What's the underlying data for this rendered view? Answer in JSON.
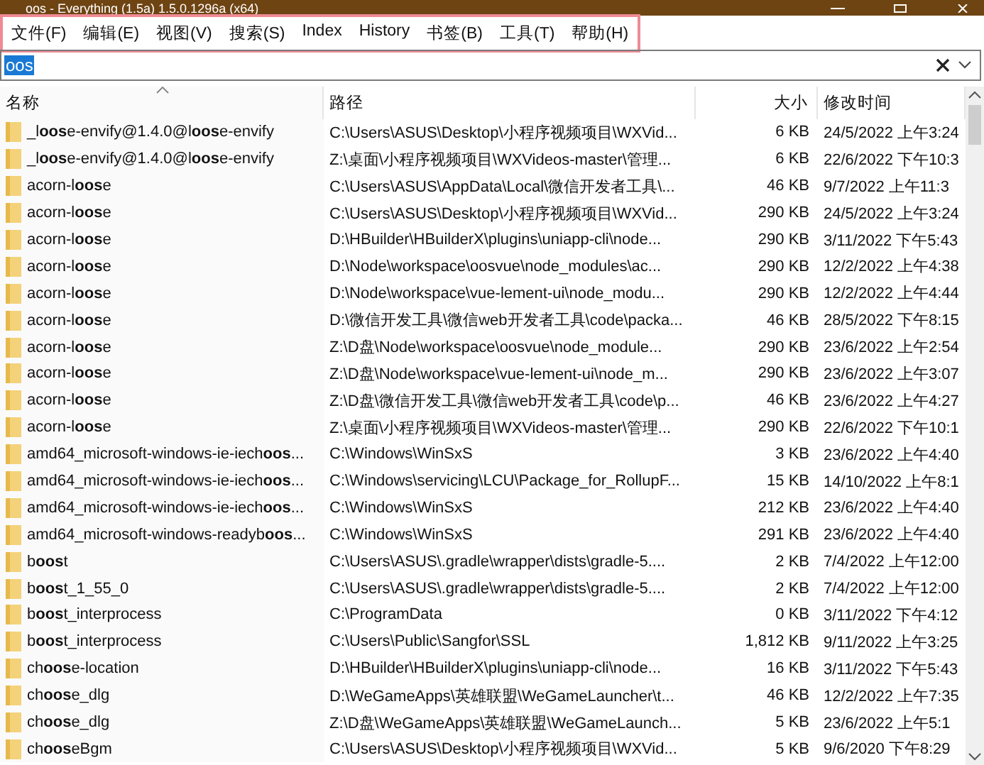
{
  "window": {
    "title": "oos - Everything (1.5a) 1.5.0.1296a (x64)"
  },
  "menu": {
    "highlighted": true,
    "items": [
      "文件(F)",
      "编辑(E)",
      "视图(V)",
      "搜索(S)",
      "Index",
      "History",
      "书签(B)",
      "工具(T)",
      "帮助(H)"
    ]
  },
  "search": {
    "value": "oos",
    "text_selected": true
  },
  "table": {
    "columns": [
      {
        "label": "名称",
        "sorted": true
      },
      {
        "label": "路径",
        "sorted": false
      },
      {
        "label": "大小",
        "sorted": false
      },
      {
        "label": "修改时间",
        "sorted": false
      }
    ],
    "rows": [
      {
        "name": "_l**oos**e-envify@1.4.0@l**oos**e-envify",
        "path": "C:\\Users\\ASUS\\Desktop\\小程序视频项目\\WXVid...",
        "size": "6 KB",
        "modified": "24/5/2022 上午3:24"
      },
      {
        "name": "_l**oos**e-envify@1.4.0@l**oos**e-envify",
        "path": "Z:\\桌面\\小程序视频项目\\WXVideos-master\\管理...",
        "size": "6 KB",
        "modified": "22/6/2022 下午10:3"
      },
      {
        "name": "acorn-l**oos**e",
        "path": "C:\\Users\\ASUS\\AppData\\Local\\微信开发者工具\\...",
        "size": "46 KB",
        "modified": "9/7/2022 上午11:3"
      },
      {
        "name": "acorn-l**oos**e",
        "path": "C:\\Users\\ASUS\\Desktop\\小程序视频项目\\WXVid...",
        "size": "290 KB",
        "modified": "24/5/2022 上午3:24"
      },
      {
        "name": "acorn-l**oos**e",
        "path": "D:\\HBuilder\\HBuilderX\\plugins\\uniapp-cli\\node...",
        "size": "290 KB",
        "modified": "3/11/2022 下午5:43"
      },
      {
        "name": "acorn-l**oos**e",
        "path": "D:\\Node\\workspace\\oosvue\\node_modules\\ac...",
        "size": "290 KB",
        "modified": "12/2/2022 上午4:38"
      },
      {
        "name": "acorn-l**oos**e",
        "path": "D:\\Node\\workspace\\vue-lement-ui\\node_modu...",
        "size": "290 KB",
        "modified": "12/2/2022 上午4:44"
      },
      {
        "name": "acorn-l**oos**e",
        "path": "D:\\微信开发工具\\微信web开发者工具\\code\\packa...",
        "size": "46 KB",
        "modified": "28/5/2022 下午8:15"
      },
      {
        "name": "acorn-l**oos**e",
        "path": "Z:\\D盘\\Node\\workspace\\oosvue\\node_module...",
        "size": "290 KB",
        "modified": "23/6/2022 上午2:54"
      },
      {
        "name": "acorn-l**oos**e",
        "path": "Z:\\D盘\\Node\\workspace\\vue-lement-ui\\node_m...",
        "size": "290 KB",
        "modified": "23/6/2022 上午3:07"
      },
      {
        "name": "acorn-l**oos**e",
        "path": "Z:\\D盘\\微信开发工具\\微信web开发者工具\\code\\p...",
        "size": "46 KB",
        "modified": "23/6/2022 上午4:27"
      },
      {
        "name": "acorn-l**oos**e",
        "path": "Z:\\桌面\\小程序视频项目\\WXVideos-master\\管理...",
        "size": "290 KB",
        "modified": "22/6/2022 下午10:1"
      },
      {
        "name": "amd64_microsoft-windows-ie-iech**oos**...",
        "path": "C:\\Windows\\WinSxS",
        "size": "3 KB",
        "modified": "23/6/2022 上午4:40"
      },
      {
        "name": "amd64_microsoft-windows-ie-iech**oos**...",
        "path": "C:\\Windows\\servicing\\LCU\\Package_for_RollupF...",
        "size": "15 KB",
        "modified": "14/10/2022 上午8:1"
      },
      {
        "name": "amd64_microsoft-windows-ie-iech**oos**...",
        "path": "C:\\Windows\\WinSxS",
        "size": "212 KB",
        "modified": "23/6/2022 上午4:40"
      },
      {
        "name": "amd64_microsoft-windows-readyb**oos**...",
        "path": "C:\\Windows\\WinSxS",
        "size": "291 KB",
        "modified": "23/6/2022 上午4:40"
      },
      {
        "name": "b**oos**t",
        "path": "C:\\Users\\ASUS\\.gradle\\wrapper\\dists\\gradle-5....",
        "size": "2 KB",
        "modified": "7/4/2022 上午12:00"
      },
      {
        "name": "b**oos**t_1_55_0",
        "path": "C:\\Users\\ASUS\\.gradle\\wrapper\\dists\\gradle-5....",
        "size": "2 KB",
        "modified": "7/4/2022 上午12:00"
      },
      {
        "name": "b**oos**t_interprocess",
        "path": "C:\\ProgramData",
        "size": "0 KB",
        "modified": "3/11/2022 下午4:12"
      },
      {
        "name": "b**oos**t_interprocess",
        "path": "C:\\Users\\Public\\Sangfor\\SSL",
        "size": "1,812 KB",
        "modified": "9/11/2022 上午3:25"
      },
      {
        "name": "ch**oos**e-location",
        "path": "D:\\HBuilder\\HBuilderX\\plugins\\uniapp-cli\\node...",
        "size": "16 KB",
        "modified": "3/11/2022 下午5:43"
      },
      {
        "name": "ch**oos**e_dlg",
        "path": "D:\\WeGameApps\\英雄联盟\\WeGameLauncher\\t...",
        "size": "46 KB",
        "modified": "12/2/2022 上午7:35"
      },
      {
        "name": "ch**oos**e_dlg",
        "path": "Z:\\D盘\\WeGameApps\\英雄联盟\\WeGameLaunch...",
        "size": "5 KB",
        "modified": "23/6/2022 上午5:1"
      },
      {
        "name": "ch**oos**eBgm",
        "path": "C:\\Users\\ASUS\\Desktop\\小程序视频项目\\WXVid...",
        "size": "5 KB",
        "modified": "9/6/2020 下午8:29"
      }
    ]
  }
}
